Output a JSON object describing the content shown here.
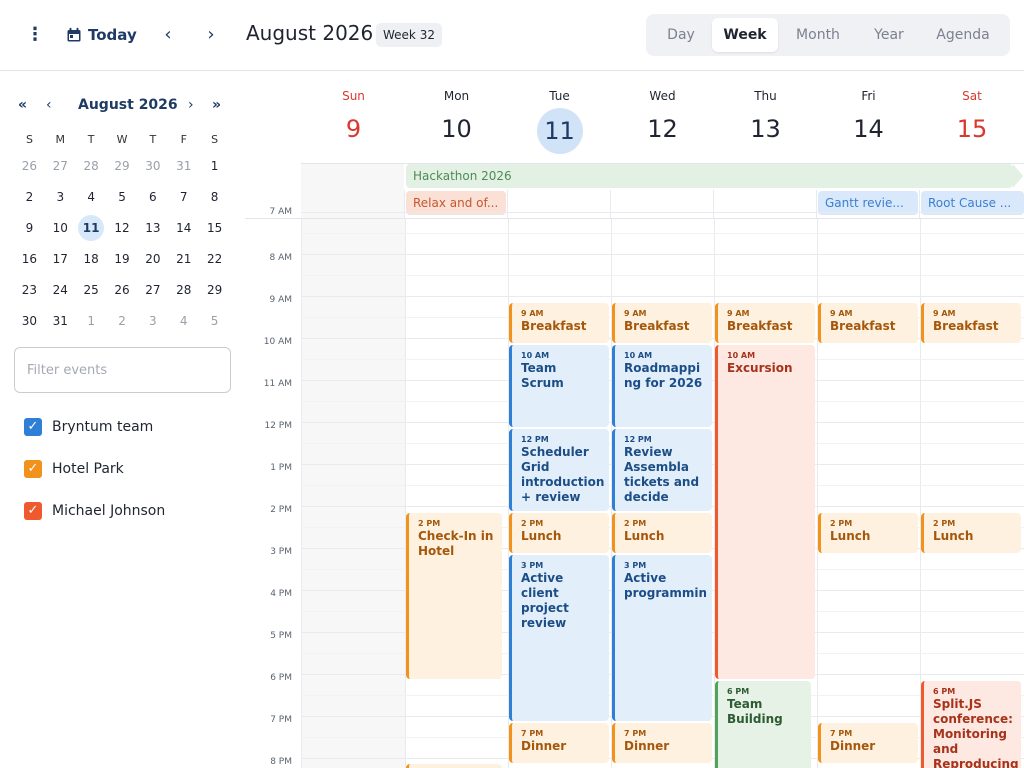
{
  "toolbar": {
    "menu_icon": "vertical-dots-icon",
    "today_icon": "calendar-icon",
    "today_label": "Today",
    "prev_icon": "chevron-left-icon",
    "next_icon": "chevron-right-icon",
    "title": "August 2026",
    "week_badge": "Week 32",
    "modes": [
      "Day",
      "Week",
      "Month",
      "Year",
      "Agenda"
    ],
    "active_mode": "Week"
  },
  "mini_calendar": {
    "title": "August 2026",
    "first_icon": "«",
    "prev_icon": "‹",
    "next_icon": "›",
    "last_icon": "»",
    "weekdays": [
      "S",
      "M",
      "T",
      "W",
      "T",
      "F",
      "S"
    ],
    "weeks": [
      [
        "26",
        "27",
        "28",
        "29",
        "30",
        "31",
        "1"
      ],
      [
        "2",
        "3",
        "4",
        "5",
        "6",
        "7",
        "8"
      ],
      [
        "9",
        "10",
        "11",
        "12",
        "13",
        "14",
        "15"
      ],
      [
        "16",
        "17",
        "18",
        "19",
        "20",
        "21",
        "22"
      ],
      [
        "23",
        "24",
        "25",
        "26",
        "27",
        "28",
        "29"
      ],
      [
        "30",
        "31",
        "1",
        "2",
        "3",
        "4",
        "5"
      ]
    ],
    "today": "11"
  },
  "filter": {
    "placeholder": "Filter events"
  },
  "resources": [
    {
      "name": "Bryntum team",
      "color": "#2f7fd6",
      "checked": true
    },
    {
      "name": "Hotel Park",
      "color": "#f0921c",
      "checked": true
    },
    {
      "name": "Michael Johnson",
      "color": "#ee5a2e",
      "checked": true
    }
  ],
  "week": {
    "days": [
      {
        "name": "Sun",
        "date": "9"
      },
      {
        "name": "Mon",
        "date": "10"
      },
      {
        "name": "Tue",
        "date": "11"
      },
      {
        "name": "Wed",
        "date": "12"
      },
      {
        "name": "Thu",
        "date": "13"
      },
      {
        "name": "Fri",
        "date": "14"
      },
      {
        "name": "Sat",
        "date": "15"
      }
    ],
    "today": "11",
    "time_labels": [
      "7 AM",
      "8 AM",
      "9 AM",
      "10 AM",
      "11 AM",
      "12 PM",
      "1 PM",
      "2 PM",
      "3 PM",
      "4 PM",
      "5 PM",
      "6 PM",
      "7 PM",
      "8 PM"
    ]
  },
  "all_day_events": [
    {
      "name": "Hackathon 2026",
      "color": "#4fa35b"
    },
    {
      "name": "Relax and of...",
      "color": "#ee5a2e"
    },
    {
      "name": "Gantt revie...",
      "color": "#2f7fd6"
    },
    {
      "name": "Root Cause ...",
      "color": "#2f7fd6"
    }
  ],
  "events": [
    {
      "time": "9 AM",
      "name": "Breakfast",
      "day": "Tue"
    },
    {
      "time": "9 AM",
      "name": "Breakfast",
      "day": "Wed"
    },
    {
      "time": "9 AM",
      "name": "Breakfast",
      "day": "Thu"
    },
    {
      "time": "9 AM",
      "name": "Breakfast",
      "day": "Fri"
    },
    {
      "time": "9 AM",
      "name": "Breakfast",
      "day": "Sat"
    },
    {
      "time": "10 AM",
      "name": "Team Scrum",
      "day": "Tue"
    },
    {
      "time": "10 AM",
      "name": "Roadmapping for 2026",
      "day": "Wed"
    },
    {
      "time": "10 AM",
      "name": "Excursion",
      "day": "Thu"
    },
    {
      "time": "12 PM",
      "name": "Scheduler Grid introduction + review",
      "day": "Tue"
    },
    {
      "time": "12 PM",
      "name": "Review Assembla tickets and decide",
      "day": "Wed"
    },
    {
      "time": "2 PM",
      "name": "Check-In in Hotel",
      "day": "Mon"
    },
    {
      "time": "2 PM",
      "name": "Lunch",
      "day": "Tue"
    },
    {
      "time": "2 PM",
      "name": "Lunch",
      "day": "Wed"
    },
    {
      "time": "2 PM",
      "name": "Lunch",
      "day": "Fri"
    },
    {
      "time": "2 PM",
      "name": "Lunch",
      "day": "Sat"
    },
    {
      "time": "3 PM",
      "name": "Active client project review",
      "day": "Tue"
    },
    {
      "time": "3 PM",
      "name": "Active programming",
      "day": "Wed"
    },
    {
      "time": "6 PM",
      "name": "Team Building",
      "day": "Thu"
    },
    {
      "time": "6 PM",
      "name": "Split.JS conference: Monitoring and Reproducing",
      "day": "Sat"
    },
    {
      "time": "7 PM",
      "name": "Dinner",
      "day": "Tue"
    },
    {
      "time": "7 PM",
      "name": "Dinner",
      "day": "Wed"
    },
    {
      "time": "7 PM",
      "name": "Dinner",
      "day": "Fri"
    }
  ]
}
